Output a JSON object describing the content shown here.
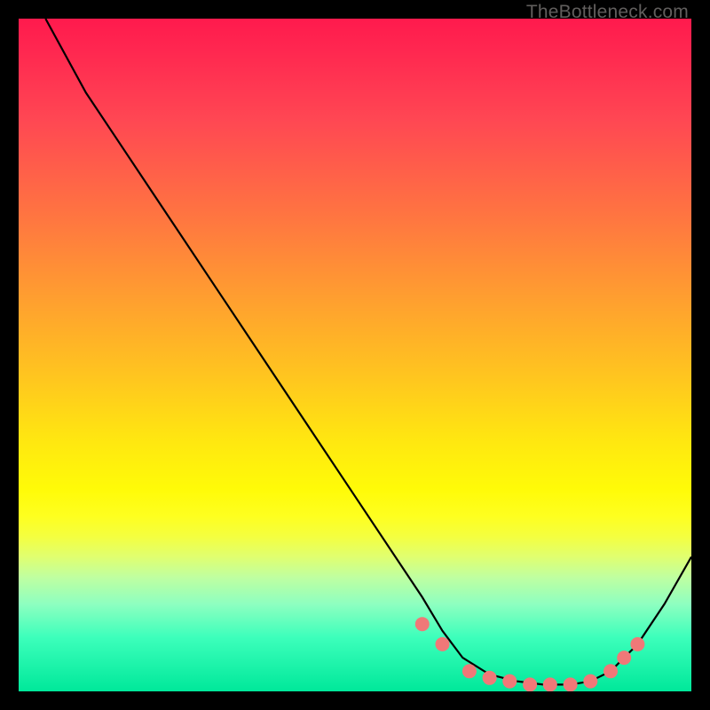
{
  "watermark": "TheBottleneck.com",
  "chart_data": {
    "type": "line",
    "title": "",
    "xlabel": "",
    "ylabel": "",
    "xlim": [
      0,
      100
    ],
    "ylim": [
      0,
      100
    ],
    "series": [
      {
        "name": "bottleneck-curve",
        "x": [
          4,
          10,
          20,
          30,
          40,
          50,
          60,
          63,
          66,
          70,
          74,
          78,
          82,
          85,
          88,
          92,
          96,
          100
        ],
        "y": [
          100,
          89,
          74,
          59,
          44,
          29,
          14,
          9,
          5,
          2.5,
          1.5,
          1,
          1,
          1.5,
          3,
          7,
          13,
          20
        ]
      }
    ],
    "markers": {
      "name": "optimal-range-dots",
      "color": "#f07878",
      "points": [
        {
          "x": 60,
          "y": 10
        },
        {
          "x": 63,
          "y": 7
        },
        {
          "x": 67,
          "y": 3
        },
        {
          "x": 70,
          "y": 2
        },
        {
          "x": 73,
          "y": 1.5
        },
        {
          "x": 76,
          "y": 1
        },
        {
          "x": 79,
          "y": 1
        },
        {
          "x": 82,
          "y": 1
        },
        {
          "x": 85,
          "y": 1.5
        },
        {
          "x": 88,
          "y": 3
        },
        {
          "x": 90,
          "y": 5
        },
        {
          "x": 92,
          "y": 7
        }
      ]
    }
  }
}
